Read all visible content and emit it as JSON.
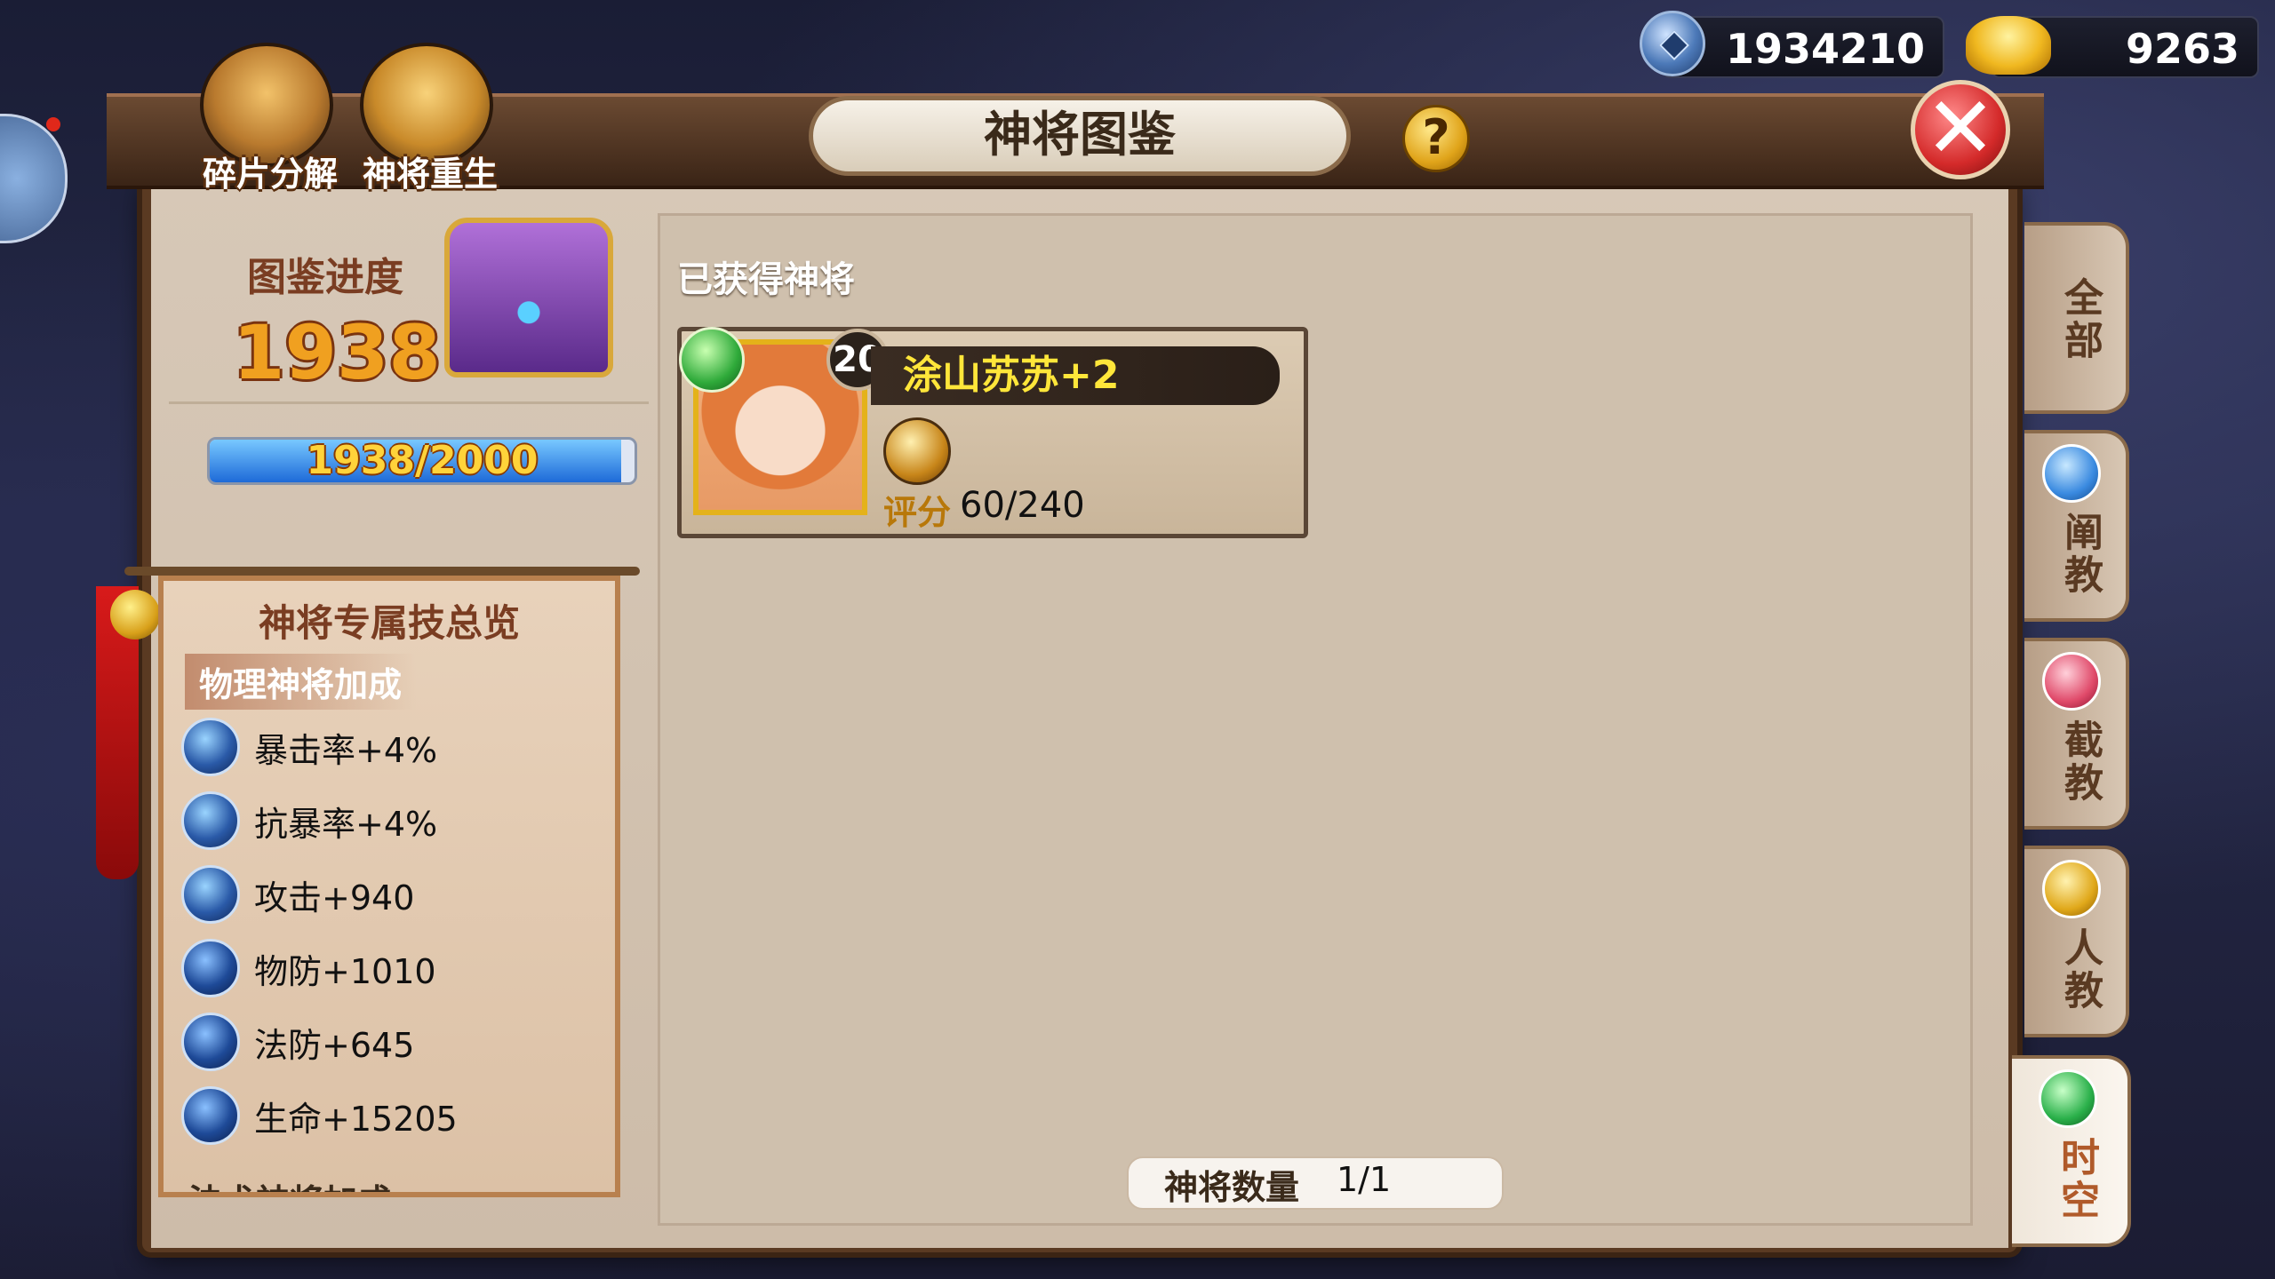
{
  "currencies": {
    "silver": {
      "icon": "coin-icon",
      "value": "1934210"
    },
    "gold": {
      "icon": "gold-ingot-icon",
      "value": "9263"
    }
  },
  "top_buttons": {
    "decompose": "碎片分解",
    "rebirth": "神将重生"
  },
  "header": {
    "title": "神将图鉴",
    "help": "?",
    "close": "✕"
  },
  "collection": {
    "label": "图鉴进度",
    "value": "1938",
    "progress_text": "1938/2000",
    "progress_fraction": 0.969
  },
  "skills_panel": {
    "title": "神将专属技总览",
    "section_physical": "物理神将加成",
    "bonuses": [
      {
        "text": "暴击率+4%"
      },
      {
        "text": "抗暴率+4%"
      },
      {
        "text": "攻击+940"
      },
      {
        "text": "物防+1010"
      },
      {
        "text": "法防+645"
      },
      {
        "text": "生命+15205"
      }
    ],
    "section_magic": "法术神将加成"
  },
  "main": {
    "obtained_label": "已获得神将",
    "hero": {
      "level": "20",
      "name": "涂山苏苏+2",
      "score_label": "评分",
      "score_value": "60/240"
    },
    "count_label": "神将数量",
    "count_value": "1/1"
  },
  "side_tabs": [
    {
      "label": "全部",
      "icon": ""
    },
    {
      "label": "阐教",
      "icon": "chan-sect-icon",
      "color": "#3a8ae0"
    },
    {
      "label": "截教",
      "icon": "jie-sect-icon",
      "color": "#e04a6a"
    },
    {
      "label": "人教",
      "icon": "human-sect-icon",
      "color": "#e0a81a"
    },
    {
      "label": "时空",
      "icon": "time-space-icon",
      "color": "#2ab04a"
    }
  ]
}
